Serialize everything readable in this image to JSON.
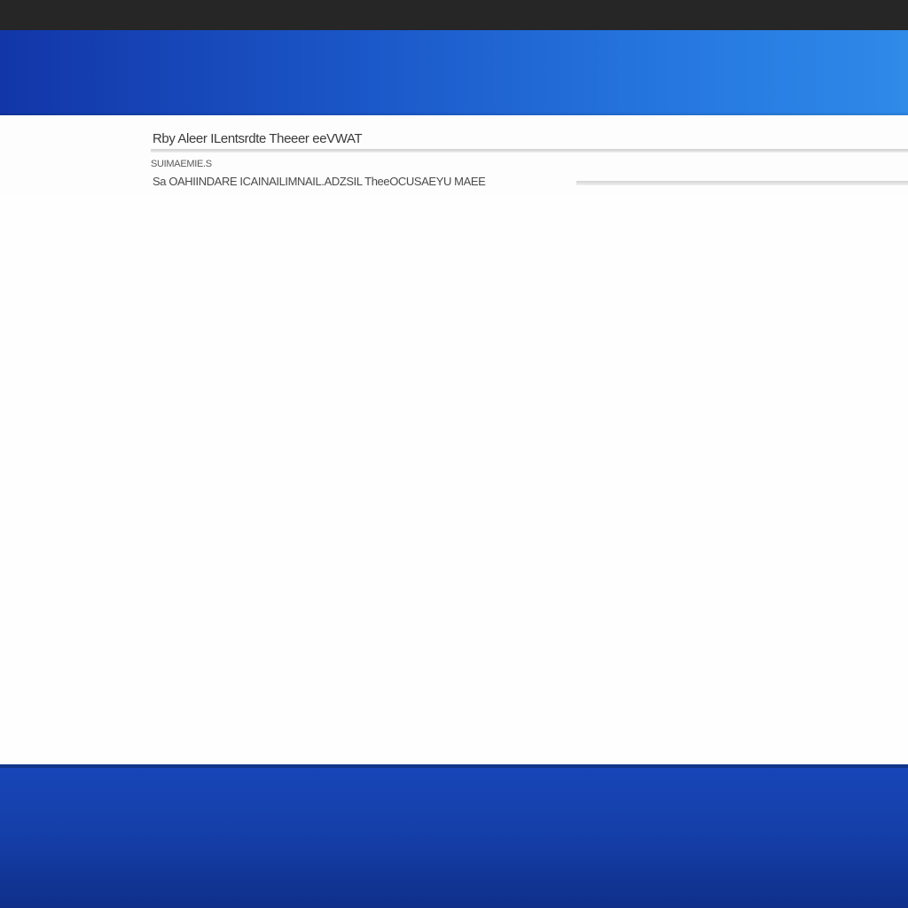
{
  "window": {
    "title": "Rby Aleer ILentsrdte Theeer eeVWAT",
    "sub_label": "SUIMAEMIE.S",
    "path": "Sa OAHIINDARE ICAINAILIMNAIL.ADZSIL TheeOCUSAEYU MAEE"
  },
  "colors": {
    "desktop_blue": "#1b57c8",
    "top_bar": "#262626",
    "window_bg": "#fdfdfd"
  }
}
